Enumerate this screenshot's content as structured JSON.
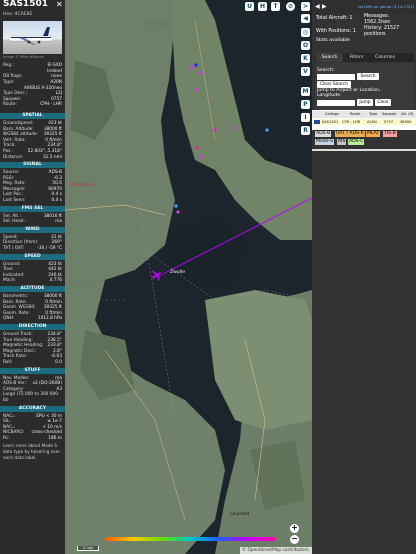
{
  "left": {
    "callsign": "SAS1501",
    "hex": "Hex: 4CAE8E",
    "close": "✕",
    "photo_credit": "Image © Mike Willeum",
    "info_rows": [
      {
        "k": "Reg.:",
        "v": "EI-SXD"
      },
      {
        "k": "",
        "v": "Ireland"
      },
      {
        "k": "DB flags:",
        "v": "none"
      },
      {
        "k": "Type:",
        "v": "A20N"
      },
      {
        "k": "",
        "v": "AIRBUS A-320neo"
      },
      {
        "k": "Type Desc.:",
        "v": "L2J"
      },
      {
        "k": "Squawk:",
        "v": "0757"
      },
      {
        "k": "Route:",
        "v": "CPH - LHR"
      }
    ],
    "spatial_title": "SPATIAL",
    "spatial_rows": [
      {
        "k": "Groundspeed:",
        "v": "423 kt"
      },
      {
        "k": "Baro. Altitude:",
        "v": "38000 ft"
      },
      {
        "k": "WGS84 altitude:",
        "v": "39325 ft"
      },
      {
        "k": "Vert. Rate:",
        "v": "0 ft/min"
      },
      {
        "k": "Track:",
        "v": "234.8°"
      },
      {
        "k": "Pos.:",
        "v": "52.803°, 5.318°"
      },
      {
        "k": "Distance:",
        "v": "31.5 nmi"
      }
    ],
    "signal_title": "SIGNAL",
    "signal_rows": [
      {
        "k": "Source:",
        "v": "ADS-B"
      },
      {
        "k": "RSSI:",
        "v": "-6.3"
      },
      {
        "k": "Msg. Rate:",
        "v": "50.6"
      },
      {
        "k": "Messages:",
        "v": "60970"
      },
      {
        "k": "Last Pos.:",
        "v": "0.4 s"
      },
      {
        "k": "Last Seen:",
        "v": "0.4 s"
      }
    ],
    "fmssel_title": "FMS SEL",
    "fmssel_rows": [
      {
        "k": "Sel. Alt.:",
        "v": "38016 ft"
      },
      {
        "k": "Sel. Head.:",
        "v": "n/a"
      }
    ],
    "wind_title": "WIND",
    "wind_rows": [
      {
        "k": "Speed:",
        "v": "22 kt"
      },
      {
        "k": "Direction (from):",
        "v": "269°"
      },
      {
        "k": "TAT / OAT:",
        "v": "-34 / -59 °C"
      }
    ],
    "speed_title": "SPEED",
    "speed_rows": [
      {
        "k": "Ground:",
        "v": "423 kt"
      },
      {
        "k": "True:",
        "v": "442 kt"
      },
      {
        "k": "Indicated:",
        "v": "246 kt"
      },
      {
        "k": "Mach:",
        "v": "0.776"
      }
    ],
    "altitude_title": "ALTITUDE",
    "altitude_rows": [
      {
        "k": "Barometric:",
        "v": "38000 ft"
      },
      {
        "k": "Baro. Rate:",
        "v": "0 ft/min"
      },
      {
        "k": "Geom. WGS84:",
        "v": "39325 ft"
      },
      {
        "k": "Geom. Rate:",
        "v": "0 ft/min"
      },
      {
        "k": "QNH:",
        "v": "1012.8 hPa"
      }
    ],
    "direction_title": "DIRECTION",
    "direction_rows": [
      {
        "k": "Ground Track:",
        "v": "234.8°"
      },
      {
        "k": "True Heading:",
        "v": "236.5°"
      },
      {
        "k": "Magnetic Heading:",
        "v": "233.8°"
      },
      {
        "k": "Magnetic Decl.:",
        "v": "2.8°"
      },
      {
        "k": "Track Rate:",
        "v": "-0.03"
      },
      {
        "k": "Roll:",
        "v": "0.0"
      }
    ],
    "stuff_title": "STUFF",
    "stuff_rows": [
      {
        "k": "Nav. Modes:",
        "v": "n/a"
      },
      {
        "k": "ADS-B Ver.:",
        "v": "v2 (DO-260B)"
      },
      {
        "k": "Category:",
        "v": "A3"
      },
      {
        "k": "Large (75 000 to 300 000 lb)",
        "v": ""
      }
    ],
    "accuracy_title": "ACCURACY",
    "accuracy_rows": [
      {
        "k": "NACₚ:",
        "v": "EPU < 30 m"
      },
      {
        "k": "SIL:",
        "v": "≤ 1e-7"
      },
      {
        "k": "NACᵥ:",
        "v": "< 10 m/s"
      },
      {
        "k": "NICBARO:",
        "v": "cross-checked"
      },
      {
        "k": "Rc:",
        "v": "186 m"
      }
    ],
    "footer": "Learn more about Mode S data type by hovering over each data label."
  },
  "map": {
    "buttons_top": [
      "U",
      "H",
      "T"
    ],
    "buttons_side": [
      "O",
      "K",
      "V",
      "M",
      "P",
      "I",
      "R"
    ],
    "scale": "1 nmi",
    "attribution": "© OpenStreetMap contributors.",
    "place_labels": [
      "Amsterdam",
      "Zwolle",
      "Lelystad"
    ],
    "colors": {
      "track_purple": "#c000ff",
      "aircraft": "#c000ff",
      "land": "#7a8c75",
      "water": "#1c252b"
    }
  },
  "right": {
    "update_link": "tar1090 on github (3.14.1751)",
    "total_aircraft": "Total Aircraft: 1",
    "with_positions": "With Positions: 1",
    "messages": "Messages:",
    "messages_rate": "1562.3/sec",
    "history": "History: 21527",
    "history_positions": "positions",
    "stats_link": "Stats available",
    "tabs": [
      "Search",
      "Filters",
      "Columns"
    ],
    "search_label": "Search:",
    "search_button": "Search",
    "clear_button": "Clear Search",
    "jump_label": "Jump to Airport or Location,",
    "jump_label2": "Longitude:",
    "jump_button": "Jump",
    "clear2_button": "Clear",
    "table_headers": [
      "Callsign",
      "Route",
      "Type",
      "Squawk",
      "Alt. (ft)"
    ],
    "table_row": [
      "SAS1501",
      "CPH - LHR",
      "A20N",
      "0757",
      "38000"
    ],
    "legend": [
      {
        "label": "ADS-B",
        "color": "#d8d8d8"
      },
      {
        "label": "UAT / ADS-R",
        "color": "#e7b052"
      },
      {
        "label": "MLAT",
        "color": "#f2a94e"
      },
      {
        "label": "TIS-B",
        "color": "#f7a0a0"
      },
      {
        "label": "Mode-S",
        "color": "#c4d4e4"
      },
      {
        "label": "AIS",
        "color": "#c0c0c0"
      },
      {
        "label": "ADS-C",
        "color": "#b9ea9a"
      }
    ]
  }
}
